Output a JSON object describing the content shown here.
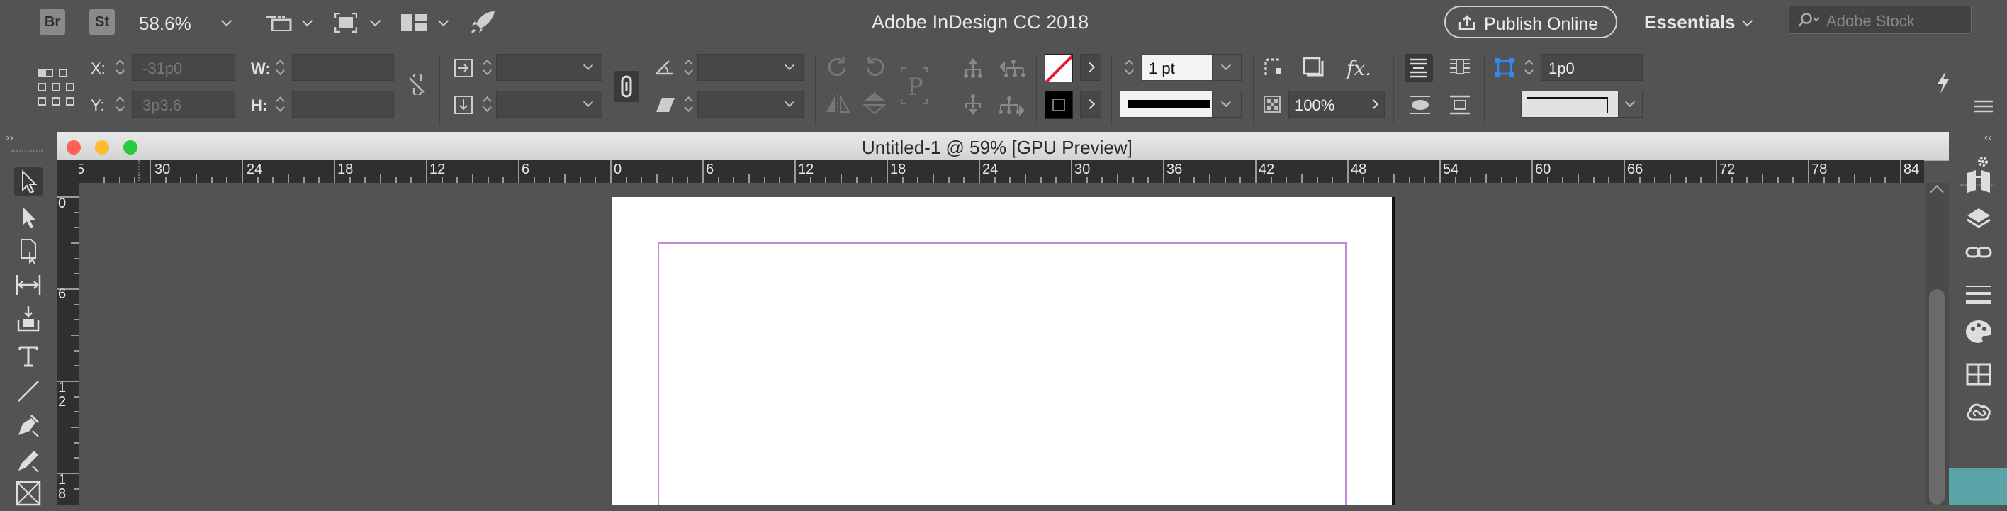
{
  "app": {
    "title": "Adobe InDesign CC 2018",
    "br_label": "Br",
    "st_label": "St",
    "zoom": "58.6%",
    "publish_label": "Publish Online",
    "workspace": "Essentials",
    "search_placeholder": "Adobe Stock"
  },
  "control": {
    "x_label": "X:",
    "x_value": "-31p0",
    "y_label": "Y:",
    "y_value": "3p3.6",
    "w_label": "W:",
    "h_label": "H:",
    "stroke_weight": "1 pt",
    "opacity": "100%",
    "offset": "1p0",
    "fx_label": "fx."
  },
  "document": {
    "title": "Untitled-1 @ 59% [GPU Preview]"
  },
  "rulers": {
    "h_labels": [
      "5",
      "30",
      "24",
      "18",
      "12",
      "6",
      "0",
      "6",
      "12",
      "18",
      "24",
      "30",
      "36",
      "42",
      "48",
      "54",
      "60",
      "66",
      "72",
      "78",
      "84"
    ],
    "v_labels": [
      "0",
      "6",
      "1",
      "2",
      "1",
      "8"
    ]
  },
  "colors": {
    "ui_gray": "#535353",
    "ruler": "#2f2f2f",
    "margin_guide": "#c78ad8",
    "close": "#fe5f57",
    "minimize": "#febc2e",
    "zoom": "#28c840",
    "teal": "#5aa3a6"
  }
}
